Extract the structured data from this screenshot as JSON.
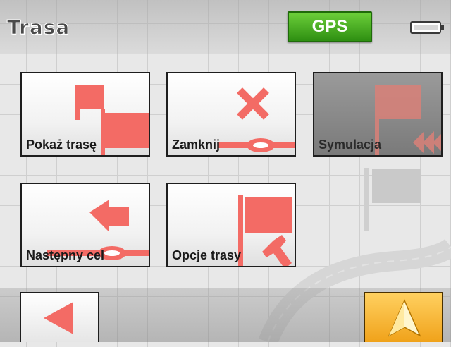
{
  "header": {
    "title": "Trasa",
    "gps_label": "GPS",
    "status_icons": [
      "battery-icon"
    ]
  },
  "menu": {
    "items": [
      {
        "label": "Pokaż trasę",
        "icon": "show-route-flags-icon",
        "enabled": true
      },
      {
        "label": "Zamknij",
        "icon": "close-route-icon",
        "enabled": true
      },
      {
        "label": "Symulacja",
        "icon": "simulation-icon",
        "enabled": false
      },
      {
        "label": "Następny cel",
        "icon": "next-destination-icon",
        "enabled": true
      },
      {
        "label": "Opcje trasy",
        "icon": "route-options-icon",
        "enabled": true
      }
    ]
  },
  "footer": {
    "back_icon": "back-arrow-icon",
    "navigate_icon": "navigation-arrow-icon"
  },
  "colors": {
    "accent_red": "#f36b65",
    "gps_green": "#3fa61c",
    "nav_orange": "#f5b130"
  }
}
